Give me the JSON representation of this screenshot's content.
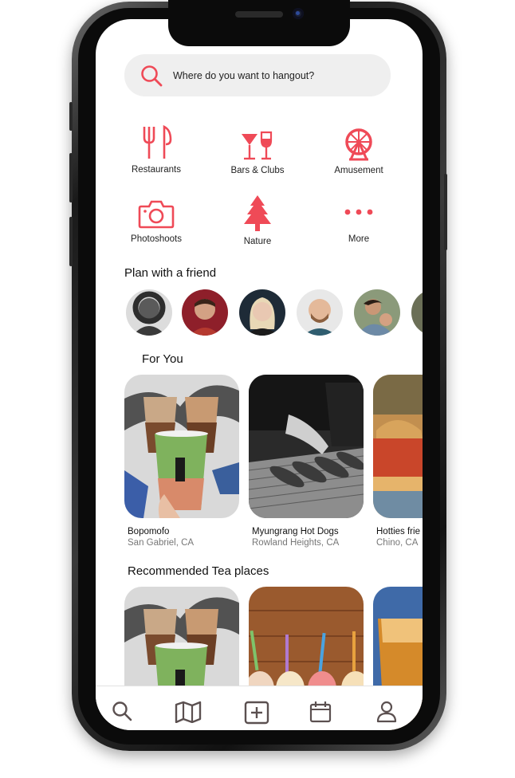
{
  "search": {
    "placeholder": "Where do you want to hangout?"
  },
  "categories": [
    {
      "label": "Restaurants",
      "icon": "fork-knife-icon"
    },
    {
      "label": "Bars & Clubs",
      "icon": "cocktail-wine-icon"
    },
    {
      "label": "Amusement",
      "icon": "ferris-wheel-icon"
    },
    {
      "label": "Photoshoots",
      "icon": "camera-icon"
    },
    {
      "label": "Nature",
      "icon": "pine-tree-icon"
    },
    {
      "label": "More",
      "icon": "more-dots-icon"
    }
  ],
  "friends": {
    "title": "Plan with a friend"
  },
  "for_you": {
    "title": "For You",
    "items": [
      {
        "name": "Bopomofo",
        "location": "San Gabriel, CA"
      },
      {
        "name": "Myungrang Hot Dogs",
        "location": "Rowland Heights, CA"
      },
      {
        "name": "Hotties frie",
        "location": "Chino, CA"
      }
    ]
  },
  "tea": {
    "title": "Recommended Tea places"
  },
  "tabbar": [
    "search-icon",
    "map-icon",
    "add-icon",
    "calendar-icon",
    "profile-icon"
  ],
  "colors": {
    "accent": "#ef4a57",
    "tab_icon": "#5b5050"
  }
}
